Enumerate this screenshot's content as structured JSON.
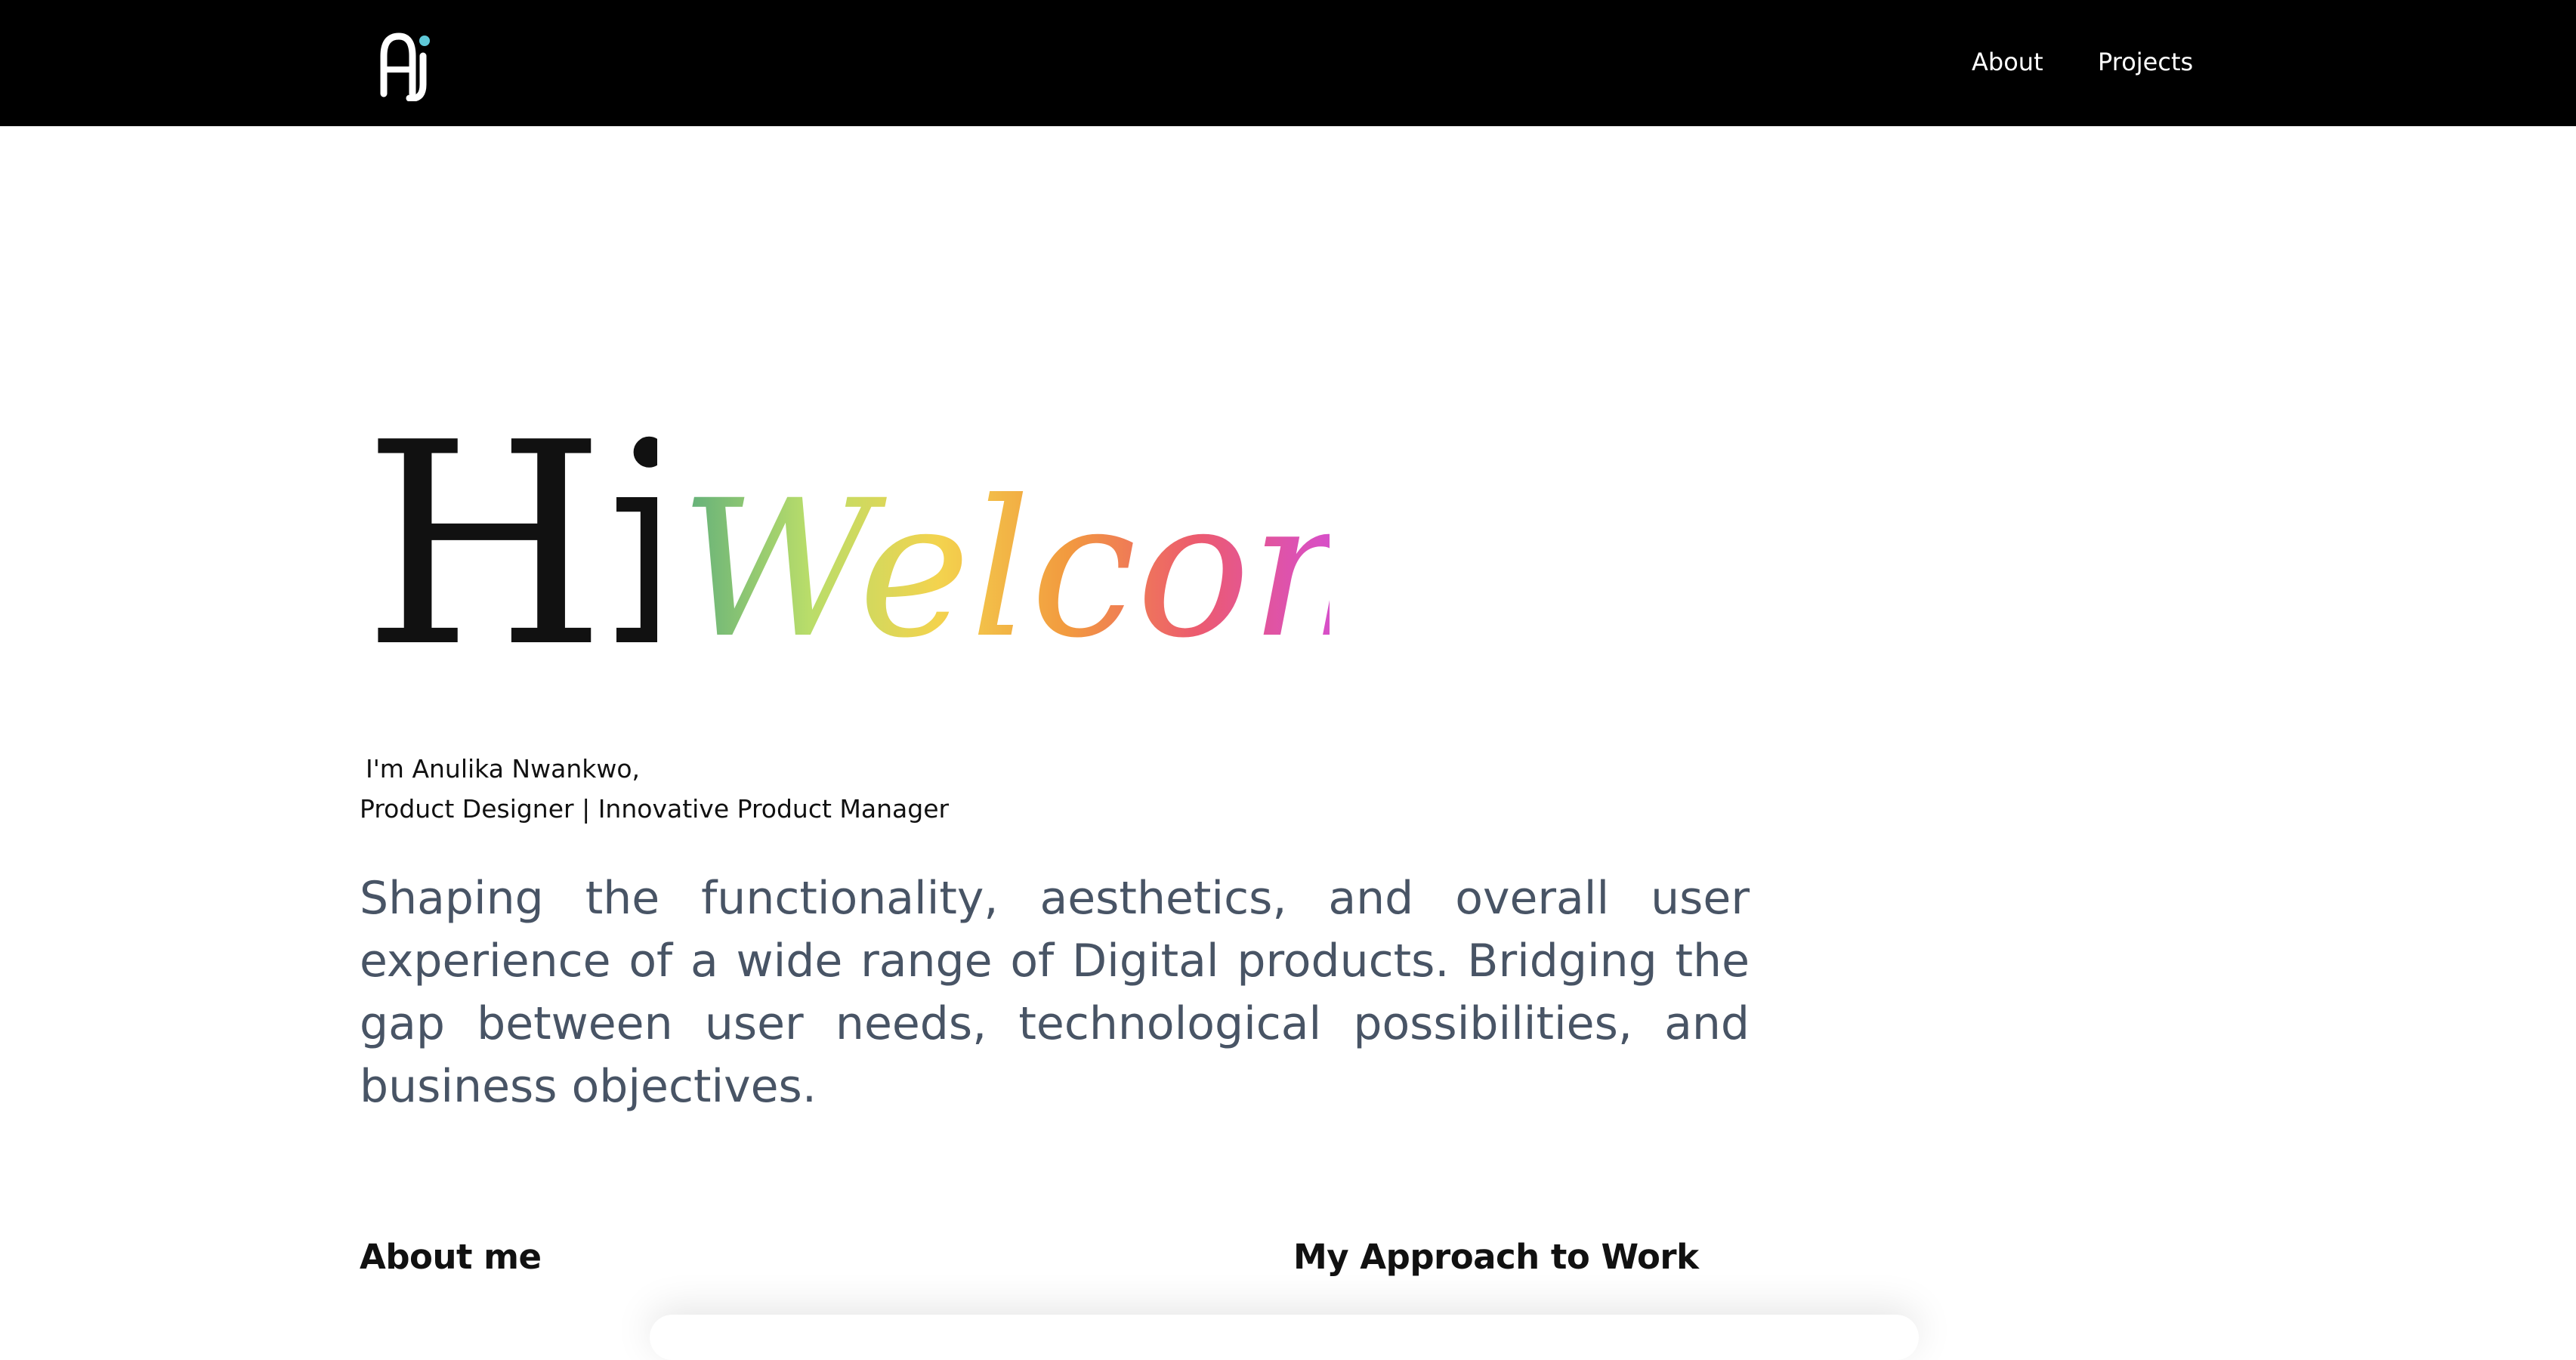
{
  "header": {
    "logo_text": "AJ",
    "nav": {
      "about": "About",
      "projects": "Projects"
    }
  },
  "hero": {
    "greeting": "Hi,",
    "welcome": "Welcome",
    "welcome_gradient": [
      "#5fae7b",
      "#b9dd6a",
      "#f3d34e",
      "#f29a3f",
      "#ec5b6f",
      "#d84fc6",
      "#8f7ee6",
      "#5ab7f0"
    ],
    "intro_name": "I'm Anulika Nwankwo,",
    "intro_role": "Product Designer  | Innovative Product Manager",
    "tagline": "Shaping the functionality, aesthetics, and overall user experience of a wide range of Digital products. Bridging the gap between user needs, technological possibilities, and business objectives."
  },
  "sections": {
    "about_heading": "About me",
    "approach_heading": "My Approach to Work"
  },
  "colors": {
    "header_bg": "#000000",
    "logo_dot": "#5fc9d8",
    "tagline": "#485465"
  }
}
